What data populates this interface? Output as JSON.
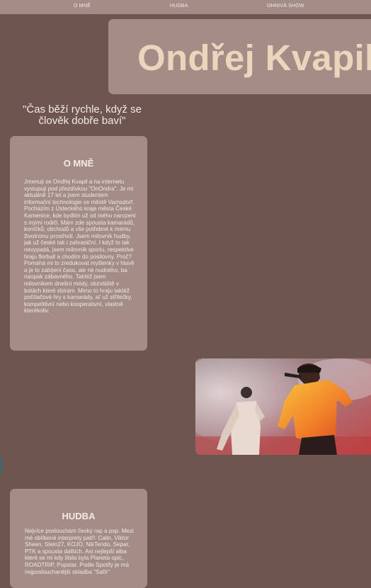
{
  "nav": {
    "items": [
      {
        "label": "O MNĚ"
      },
      {
        "label": "HUDBA"
      },
      {
        "label": "OHNIVÁ SHOW"
      }
    ]
  },
  "header": {
    "title": "Ondřej Kvapil"
  },
  "quote": "\"Čas běží rychle, když se člověk dobře baví\"",
  "about": {
    "heading": "O MNĚ",
    "text": "Jmenuji se Ondřej Kvapil a na internetu vystupuji pod přezdívkou \"OnOndra\". Je mi aktuálně 17 let a jsem studentem informační technologie ve městě Varnsdorf. Pocházím z Ústeckého kraje města České Kamenice, kde bydlím už od mého narození s mými rodiči. Mám zde spousta kamarádů, koníčků, obchodů a vše potřebné k mému životnímu prostředí. Jsem milovník hudby, jak už české tak i zahraniční. I když to tak nevypadá, jsem milovník sportu, respektive hraju florball a chodím do posilovny. Proč? Pomáhá mi to zredukovat myšlenky v hlavě a je to zabíjení času, ale né nudného, ba naopak zábavného. Taktéž jsem milovníkem dnešní módy, obzvláště v botách které sbírám. Mimo to hraju taktéž počítačové hry s kamarády, ať už střílečky, kompetitivní nebo kooperativní, vlastně kterékoliv."
  },
  "music": {
    "heading": "HUDBA",
    "text": "Nejvíce poslouchám český rap a pop. Mezi mé oblíbené interprety patří: Calin, Viktor Sheen, Stein27, KOJO, NikTendo, Separ, PTK a spousta dalších. Asi nejlepší alba které se mi kdy líbila byla Planeta opic, ROADTRIP, Popstar. Podle Spotify je má nejposlouchanější skladba \"Safír\""
  },
  "photo": {
    "icon": "concert-photo"
  },
  "colors": {
    "background": "#6e5550",
    "panel": "#a38d86",
    "title": "#e9d6bd",
    "text": "#f3ebe3"
  }
}
